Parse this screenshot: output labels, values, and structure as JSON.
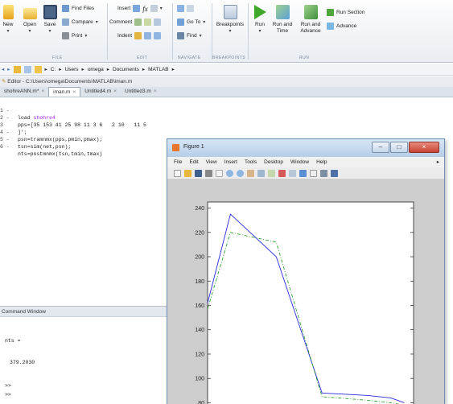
{
  "toolstrip": {
    "new_label": "New",
    "open_label": "Open",
    "save_label": "Save",
    "find_files": "Find Files",
    "compare": "Compare",
    "print": "Print",
    "insert": "Insert",
    "comment": "Comment",
    "indent": "Indent",
    "go_to": "Go To",
    "find": "Find",
    "breakpoints": "Breakpoints",
    "run": "Run",
    "run_and_time_1": "Run and",
    "run_and_time_2": "Time",
    "run_and_advance_1": "Run and",
    "run_and_advance_2": "Advance",
    "run_section": "Run Section",
    "advance": "Advance",
    "sections": {
      "file": "FILE",
      "edit": "EDIT",
      "navigate": "NAVIGATE",
      "breakpoints": "BREAKPOINTS",
      "run": "RUN"
    }
  },
  "address": {
    "path": [
      "C:",
      "Users",
      "omega",
      "Documents",
      "MATLAB"
    ]
  },
  "editor": {
    "title": "Editor - C:\\Users\\omega\\Documents\\MATLAB\\iman.m",
    "tabs": [
      "shohreANN.m*",
      "iman.m",
      "Untitled4.m",
      "Untitled3.m"
    ],
    "active_tab": 1,
    "lines": [
      {
        "gutter": "1 -",
        "pre": "load ",
        "str": "shohre4",
        "post": ""
      },
      {
        "gutter": "2 -",
        "pre": "pps=[35 153 41 25 98 11 3 6   2 10   11 5",
        "str": "",
        "post": ""
      },
      {
        "gutter": "3",
        "pre": "]';",
        "str": "",
        "post": ""
      },
      {
        "gutter": "4 -",
        "pre": "psn=tramnmx(pps,pmin,pmax);",
        "str": "",
        "post": ""
      },
      {
        "gutter": "5 -",
        "pre": "tsn=sim(net,psn);",
        "str": "",
        "post": ""
      },
      {
        "gutter": "6 -",
        "pre": "nts=postmnmx(tsn,tmin,tmax)",
        "str": "",
        "post": ""
      }
    ]
  },
  "command_window": {
    "title": "Command Window",
    "lines": [
      "nts =",
      "379.2030",
      ">>",
      ">>"
    ]
  },
  "figure": {
    "title": "Figure 1",
    "menu": [
      "File",
      "Edit",
      "View",
      "Insert",
      "Tools",
      "Desktop",
      "Window",
      "Help"
    ]
  },
  "colors": {
    "series_solid": "#2a2ae0",
    "series_dashed": "#2ea02e",
    "figure_frame": "#b9d0ea"
  },
  "chart_data": {
    "type": "line",
    "title": "",
    "xlabel": "",
    "ylabel": "",
    "ylim": [
      75,
      245
    ],
    "xlim": [
      1,
      10
    ],
    "yticks": [
      80,
      100,
      120,
      140,
      160,
      180,
      200,
      220,
      240
    ],
    "series": [
      {
        "style": "solid",
        "x": [
          1,
          2,
          4,
          6,
          8,
          9,
          9.6
        ],
        "y": [
          162,
          235,
          200,
          88,
          86,
          84,
          80
        ]
      },
      {
        "style": "dashdot",
        "x": [
          1,
          2,
          4,
          6,
          8,
          9,
          9.6
        ],
        "y": [
          157,
          220,
          212,
          85,
          82,
          80,
          78
        ]
      }
    ]
  }
}
